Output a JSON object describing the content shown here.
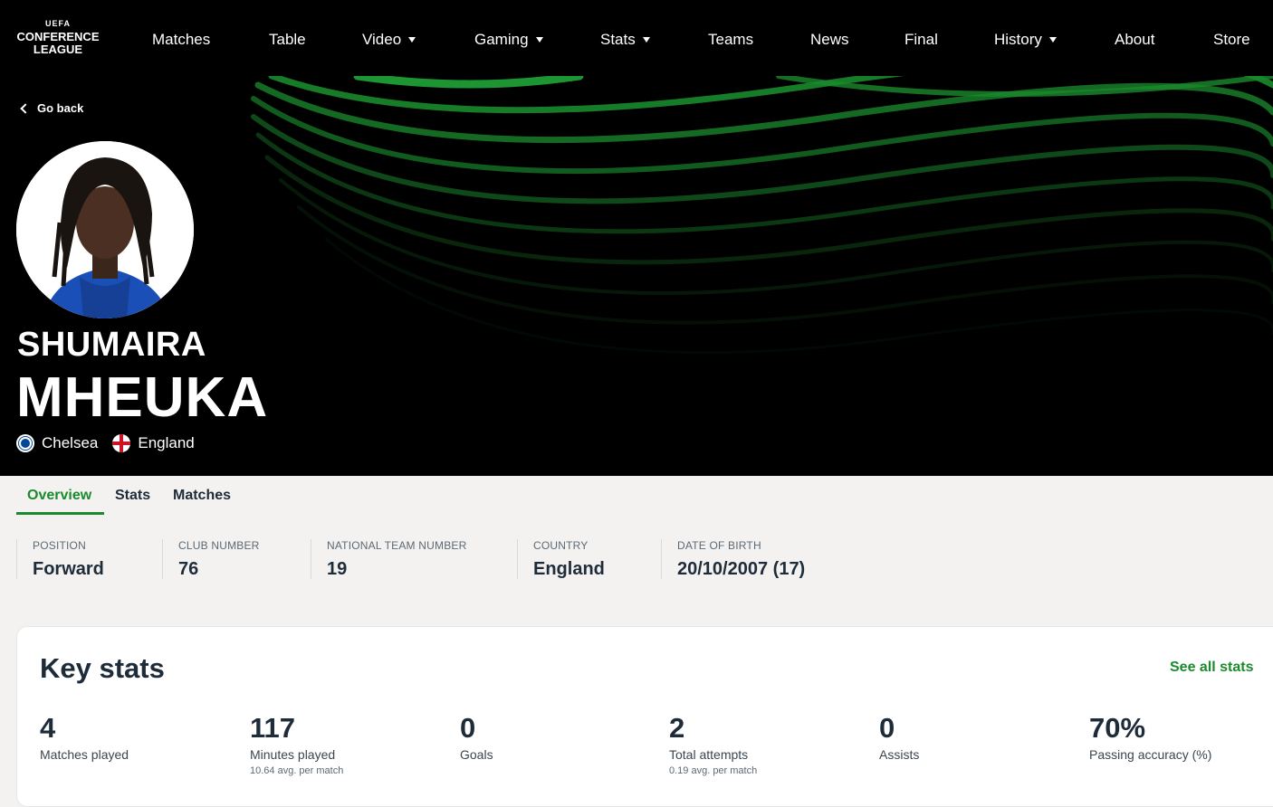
{
  "logo": {
    "line1": "UEFA",
    "line2": "CONFERENCE",
    "line3": "LEAGUE"
  },
  "nav": {
    "items": [
      {
        "label": "Matches"
      },
      {
        "label": "Table"
      },
      {
        "label": "Video"
      },
      {
        "label": "Gaming"
      },
      {
        "label": "Stats"
      },
      {
        "label": "Teams"
      },
      {
        "label": "News"
      },
      {
        "label": "Final"
      },
      {
        "label": "History"
      },
      {
        "label": "About"
      },
      {
        "label": "Store"
      }
    ]
  },
  "hero": {
    "back_label": "Go back",
    "first_name": "SHUMAIRA",
    "last_name": "MHEUKA",
    "club": "Chelsea",
    "country": "England"
  },
  "tabs": [
    {
      "label": "Overview"
    },
    {
      "label": "Stats"
    },
    {
      "label": "Matches"
    }
  ],
  "info": [
    {
      "label": "POSITION",
      "value": "Forward"
    },
    {
      "label": "CLUB NUMBER",
      "value": "76"
    },
    {
      "label": "NATIONAL TEAM NUMBER",
      "value": "19"
    },
    {
      "label": "COUNTRY",
      "value": "England"
    },
    {
      "label": "DATE OF BIRTH",
      "value": "20/10/2007 (17)"
    }
  ],
  "key_stats": {
    "title": "Key stats",
    "see_all": "See all stats",
    "items": [
      {
        "value": "4",
        "label": "Matches played",
        "sub": ""
      },
      {
        "value": "117",
        "label": "Minutes played",
        "sub": "10.64 avg. per match"
      },
      {
        "value": "0",
        "label": "Goals",
        "sub": ""
      },
      {
        "value": "2",
        "label": "Total attempts",
        "sub": "0.19 avg. per match"
      },
      {
        "value": "0",
        "label": "Assists",
        "sub": ""
      },
      {
        "value": "70%",
        "label": "Passing accuracy (%)",
        "sub": ""
      }
    ]
  },
  "colors": {
    "accent_green": "#1a8a2c",
    "dark_text": "#1e2b39",
    "hero_bg": "#000000"
  }
}
